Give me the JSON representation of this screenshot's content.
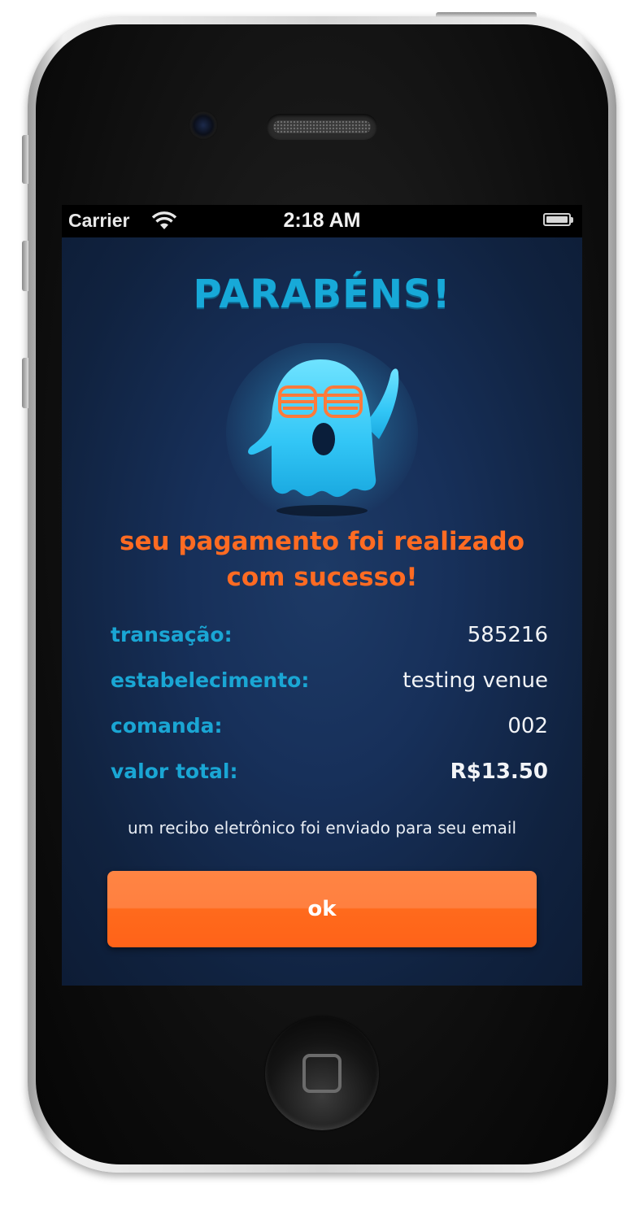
{
  "status_bar": {
    "carrier": "Carrier",
    "time": "2:18 AM",
    "icons": [
      "wifi-icon",
      "battery-icon"
    ]
  },
  "screen": {
    "title": "PARABÉNS!",
    "illustration": "ghost-with-shutter-shades-icon",
    "message_line1": "seu pagamento foi realizado",
    "message_line2": "com sucesso!",
    "details": [
      {
        "label": "transação:",
        "value": "585216"
      },
      {
        "label": "estabelecimento:",
        "value": "testing venue"
      },
      {
        "label": "comanda:",
        "value": "002"
      },
      {
        "label": "valor total:",
        "value": "R$13.50"
      }
    ],
    "receipt_note": "um recibo eletrônico foi enviado para seu email",
    "ok_label": "ok"
  },
  "colors": {
    "background": "#17305a",
    "title": "#17a9d8",
    "message": "#ff6b22",
    "label": "#1aa6d4",
    "button": "#ff6a1c",
    "ghost": "#3ccdfc",
    "shades": "#ff7a3a"
  }
}
